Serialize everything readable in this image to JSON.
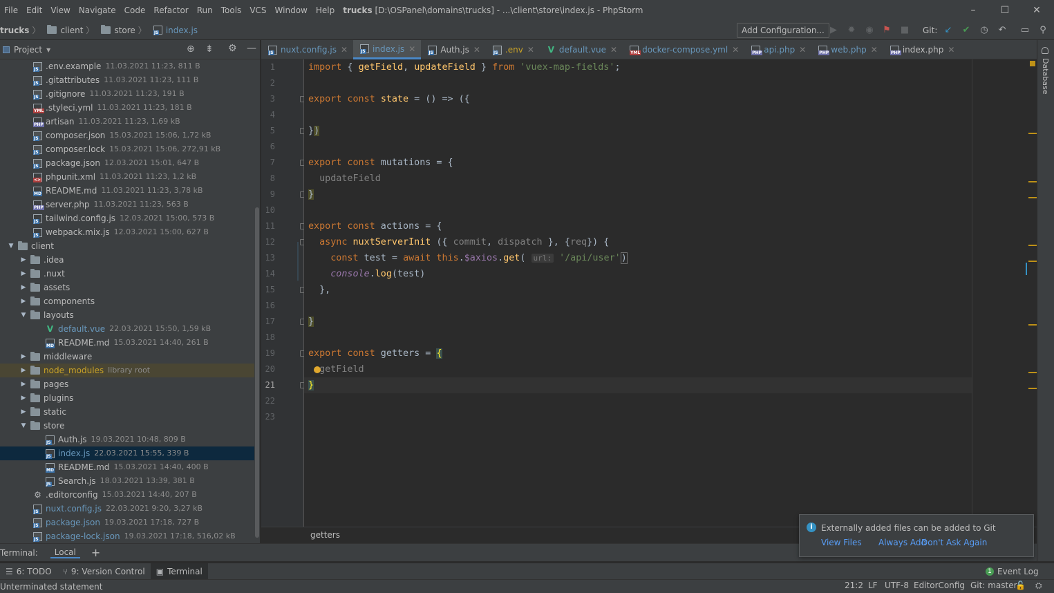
{
  "menu": [
    "File",
    "Edit",
    "View",
    "Navigate",
    "Code",
    "Refactor",
    "Run",
    "Tools",
    "VCS",
    "Window",
    "Help"
  ],
  "window_title": {
    "project": "trucks",
    "rest": "[D:\\OSPanel\\domains\\trucks] - ...\\client\\store\\index.js - PhpStorm"
  },
  "window_controls": {
    "minimize": "–",
    "maximize": "☐",
    "close": "✕"
  },
  "breadcrumbs": [
    "trucks",
    "client",
    "store",
    "index.js"
  ],
  "toolbar": {
    "add_config": "Add Configuration...",
    "git_label": "Git:"
  },
  "project_panel": {
    "title": "Project",
    "dropdown": "▾"
  },
  "tree": [
    {
      "name": ".env.example",
      "meta": "11.03.2021 11:23, 811 B",
      "icon": "file-icon",
      "indent": 48
    },
    {
      "name": ".gitattributes",
      "meta": "11.03.2021 11:23, 111 B",
      "icon": "file-icon",
      "indent": 48
    },
    {
      "name": ".gitignore",
      "meta": "11.03.2021 11:23, 191 B",
      "icon": "file-icon",
      "indent": 48
    },
    {
      "name": ".styleci.yml",
      "meta": "11.03.2021 11:23, 181 B",
      "icon": "yml-file-icon",
      "indent": 48
    },
    {
      "name": "artisan",
      "meta": "11.03.2021 11:23, 1,69 kB",
      "icon": "php-file-icon",
      "indent": 48
    },
    {
      "name": "composer.json",
      "meta": "15.03.2021 15:06, 1,72 kB",
      "icon": "file-icon",
      "indent": 48
    },
    {
      "name": "composer.lock",
      "meta": "15.03.2021 15:06, 272,91 kB",
      "icon": "file-icon",
      "indent": 48
    },
    {
      "name": "package.json",
      "meta": "12.03.2021 15:01, 647 B",
      "icon": "file-icon",
      "indent": 48
    },
    {
      "name": "phpunit.xml",
      "meta": "11.03.2021 11:23, 1,2 kB",
      "icon": "xml-file-icon",
      "indent": 48
    },
    {
      "name": "README.md",
      "meta": "11.03.2021 11:23, 3,78 kB",
      "icon": "md-file-icon",
      "indent": 48
    },
    {
      "name": "server.php",
      "meta": "11.03.2021 11:23, 563 B",
      "icon": "php-file-icon",
      "indent": 48
    },
    {
      "name": "tailwind.config.js",
      "meta": "12.03.2021 15:00, 573 B",
      "icon": "js-file-icon",
      "indent": 48
    },
    {
      "name": "webpack.mix.js",
      "meta": "12.03.2021 15:00, 627 B",
      "icon": "js-file-icon",
      "indent": 48
    },
    {
      "name": "client",
      "meta": "",
      "icon": "folder-icon",
      "indent": 12,
      "arrow": "▼"
    },
    {
      "name": ".idea",
      "meta": "",
      "icon": "folder-icon",
      "indent": 30,
      "arrow": "▶"
    },
    {
      "name": ".nuxt",
      "meta": "",
      "icon": "folder-icon",
      "indent": 30,
      "arrow": "▶"
    },
    {
      "name": "assets",
      "meta": "",
      "icon": "folder-icon",
      "indent": 30,
      "arrow": "▶"
    },
    {
      "name": "components",
      "meta": "",
      "icon": "folder-icon",
      "indent": 30,
      "arrow": "▶"
    },
    {
      "name": "layouts",
      "meta": "",
      "icon": "folder-icon",
      "indent": 30,
      "arrow": "▼"
    },
    {
      "name": "default.vue",
      "meta": "22.03.2021 15:50, 1,59 kB",
      "icon": "vue-file-icon",
      "indent": 66,
      "color": "#6897bb"
    },
    {
      "name": "README.md",
      "meta": "15.03.2021 14:40, 261 B",
      "icon": "md-file-icon",
      "indent": 66
    },
    {
      "name": "middleware",
      "meta": "",
      "icon": "folder-icon",
      "indent": 30,
      "arrow": "▶"
    },
    {
      "name": "node_modules",
      "meta": "library root",
      "icon": "folder-icon",
      "indent": 30,
      "arrow": "▶",
      "excluded": true,
      "color": "#c9a227"
    },
    {
      "name": "pages",
      "meta": "",
      "icon": "folder-icon",
      "indent": 30,
      "arrow": "▶"
    },
    {
      "name": "plugins",
      "meta": "",
      "icon": "folder-icon",
      "indent": 30,
      "arrow": "▶"
    },
    {
      "name": "static",
      "meta": "",
      "icon": "folder-icon",
      "indent": 30,
      "arrow": "▶"
    },
    {
      "name": "store",
      "meta": "",
      "icon": "folder-icon",
      "indent": 30,
      "arrow": "▼"
    },
    {
      "name": "Auth.js",
      "meta": "19.03.2021 10:48, 809 B",
      "icon": "js-file-icon",
      "indent": 66
    },
    {
      "name": "index.js",
      "meta": "22.03.2021 15:55, 339 B",
      "icon": "js-file-icon",
      "indent": 66,
      "selected": true,
      "color": "#6897bb"
    },
    {
      "name": "README.md",
      "meta": "15.03.2021 14:40, 400 B",
      "icon": "md-file-icon",
      "indent": 66
    },
    {
      "name": "Search.js",
      "meta": "18.03.2021 13:39, 381 B",
      "icon": "js-file-icon",
      "indent": 66
    },
    {
      "name": ".editorconfig",
      "meta": "15.03.2021 14:40, 207 B",
      "icon": "gear-file-icon",
      "indent": 48
    },
    {
      "name": "nuxt.config.js",
      "meta": "22.03.2021 9:20, 3,27 kB",
      "icon": "js-file-icon",
      "indent": 48,
      "color": "#6897bb"
    },
    {
      "name": "package.json",
      "meta": "19.03.2021 17:18, 727 B",
      "icon": "file-icon",
      "indent": 48,
      "color": "#6897bb"
    },
    {
      "name": "package-lock.json",
      "meta": "19.03.2021 17:18, 516,02 kB",
      "icon": "file-icon",
      "indent": 48,
      "color": "#6897bb"
    }
  ],
  "tabs": [
    {
      "label": "nuxt.config.js",
      "icon": "js-file-icon",
      "color": "#6897bb"
    },
    {
      "label": "index.js",
      "icon": "js-file-icon",
      "active": true,
      "color": "#6897bb"
    },
    {
      "label": "Auth.js",
      "icon": "js-file-icon"
    },
    {
      "label": ".env",
      "icon": "file-icon",
      "color": "#c9a227"
    },
    {
      "label": "default.vue",
      "icon": "vue-file-icon",
      "color": "#6897bb"
    },
    {
      "label": "docker-compose.yml",
      "icon": "yml-file-icon",
      "color": "#6897bb"
    },
    {
      "label": "api.php",
      "icon": "php-file-icon",
      "color": "#6897bb"
    },
    {
      "label": "web.php",
      "icon": "php-file-icon",
      "color": "#6897bb"
    },
    {
      "label": "index.php",
      "icon": "php-file-icon"
    }
  ],
  "line_numbers": [
    "1",
    "2",
    "3",
    "4",
    "5",
    "6",
    "7",
    "8",
    "9",
    "10",
    "11",
    "12",
    "13",
    "14",
    "15",
    "16",
    "17",
    "18",
    "19",
    "20",
    "21",
    "22",
    "23"
  ],
  "current_line": "21",
  "editor_crumb": "getters",
  "right_strip_label": "Database",
  "terminal": {
    "label": "Terminal:",
    "tab": "Local",
    "add": "+"
  },
  "toolwindows": {
    "todo": "6: TODO",
    "vcs": "9: Version Control",
    "terminal": "Terminal",
    "event_log": "Event Log",
    "event_count": "1"
  },
  "status": {
    "message": "Unterminated statement",
    "position": "21:2",
    "line_sep": "LF",
    "encoding": "UTF-8",
    "editorconfig": "EditorConfig",
    "git": "Git: master"
  },
  "notification": {
    "message": "Externally added files can be added to Git",
    "view_files": "View Files",
    "always_add": "Always Add",
    "dont_ask": "Don't Ask Again"
  },
  "code_hint_url": "url:"
}
